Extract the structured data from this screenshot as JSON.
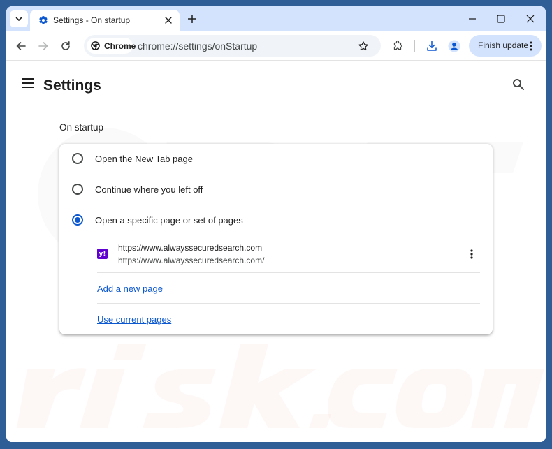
{
  "browser": {
    "tab_title": "Settings - On startup",
    "chip_label": "Chrome",
    "url": "chrome://settings/onStartup",
    "finish_update_label": "Finish update"
  },
  "settings": {
    "title": "Settings",
    "section_title": "On startup",
    "options": [
      {
        "label": "Open the New Tab page",
        "checked": false
      },
      {
        "label": "Continue where you left off",
        "checked": false
      },
      {
        "label": "Open a specific page or set of pages",
        "checked": true
      }
    ],
    "startup_page": {
      "name": "https://www.alwayssecuredsearch.com",
      "url": "https://www.alwayssecuredsearch.com/",
      "favicon_text": "y!"
    },
    "add_new_page_label": "Add a new page",
    "use_current_pages_label": "Use current pages"
  },
  "colors": {
    "accent": "#0b57d0",
    "tabstrip": "#d3e3fd",
    "favicon_bg": "#6001d2"
  }
}
